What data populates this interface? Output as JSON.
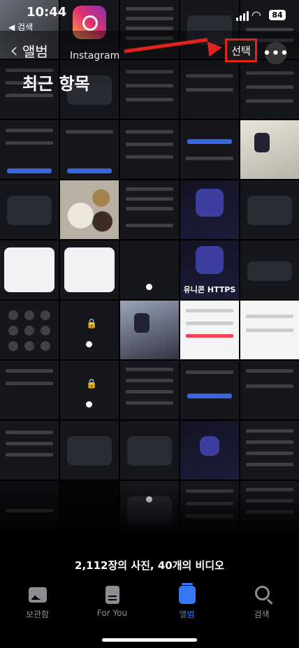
{
  "status_bar": {
    "time": "10:44",
    "back_to_app": "◀ 검색",
    "battery": "84"
  },
  "header": {
    "back_label": "앨범",
    "title": "최근 항목",
    "select_label": "선택",
    "more_label": "•••",
    "highlight_color": "#e0241b"
  },
  "thumbnails": {
    "instagram_caption": "Instagram",
    "https_caption": "유니콘 HTTPS"
  },
  "summary": "2,112장의 사진, 40개의 비디오",
  "tabs": [
    {
      "label": "보관함",
      "icon": "photo-library-icon",
      "active": false
    },
    {
      "label": "For You",
      "icon": "for-you-icon",
      "active": false
    },
    {
      "label": "앨범",
      "icon": "albums-icon",
      "active": true
    },
    {
      "label": "검색",
      "icon": "search-icon",
      "active": false
    }
  ],
  "colors": {
    "accent": "#3478f6",
    "inactive": "#8d8d92"
  }
}
